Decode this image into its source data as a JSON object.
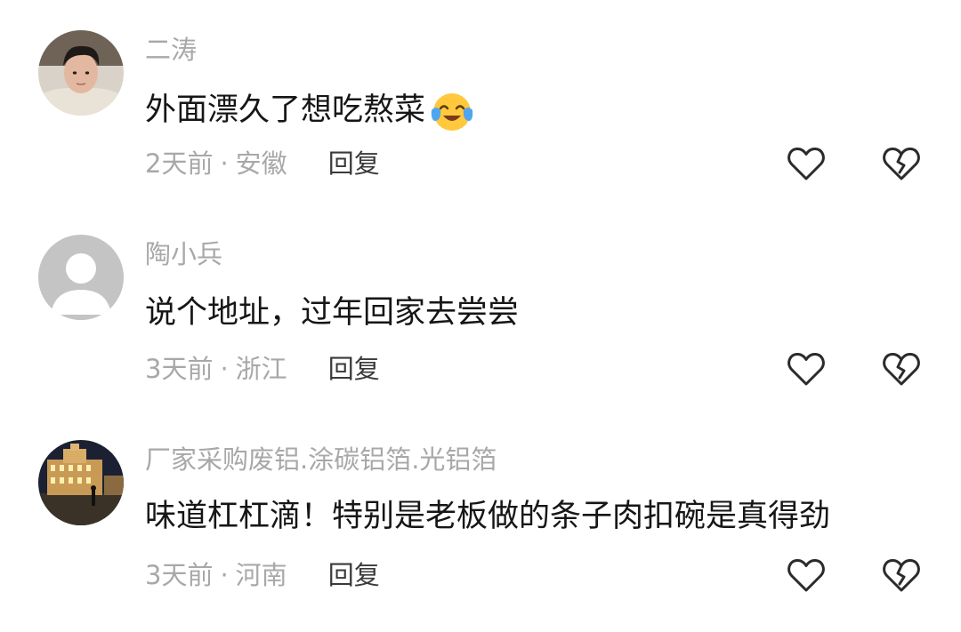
{
  "comments": [
    {
      "username": "二涛",
      "content": "外面漂久了想吃熬菜",
      "emoji": "crying-laughing-emoji",
      "time": "2天前",
      "separator": "·",
      "location": "安徽",
      "reply_label": "回复"
    },
    {
      "username": "陶小兵",
      "content": "说个地址，过年回家去尝尝",
      "time": "3天前",
      "separator": "·",
      "location": "浙江",
      "reply_label": "回复"
    },
    {
      "username": "厂家采购废铝.涂碳铝箔.光铝箔",
      "content": "味道杠杠滴！特别是老板做的条子肉扣碗是真得劲",
      "time": "3天前",
      "separator": "·",
      "location": "河南",
      "reply_label": "回复"
    }
  ],
  "icons": {
    "like": "heart-outline-icon",
    "dislike": "broken-heart-icon"
  },
  "colors": {
    "secondary_text": "#a8a8a8",
    "primary_text": "#161616",
    "reply_text": "#3a3a3a",
    "icon_stroke": "#2b2b2b"
  }
}
